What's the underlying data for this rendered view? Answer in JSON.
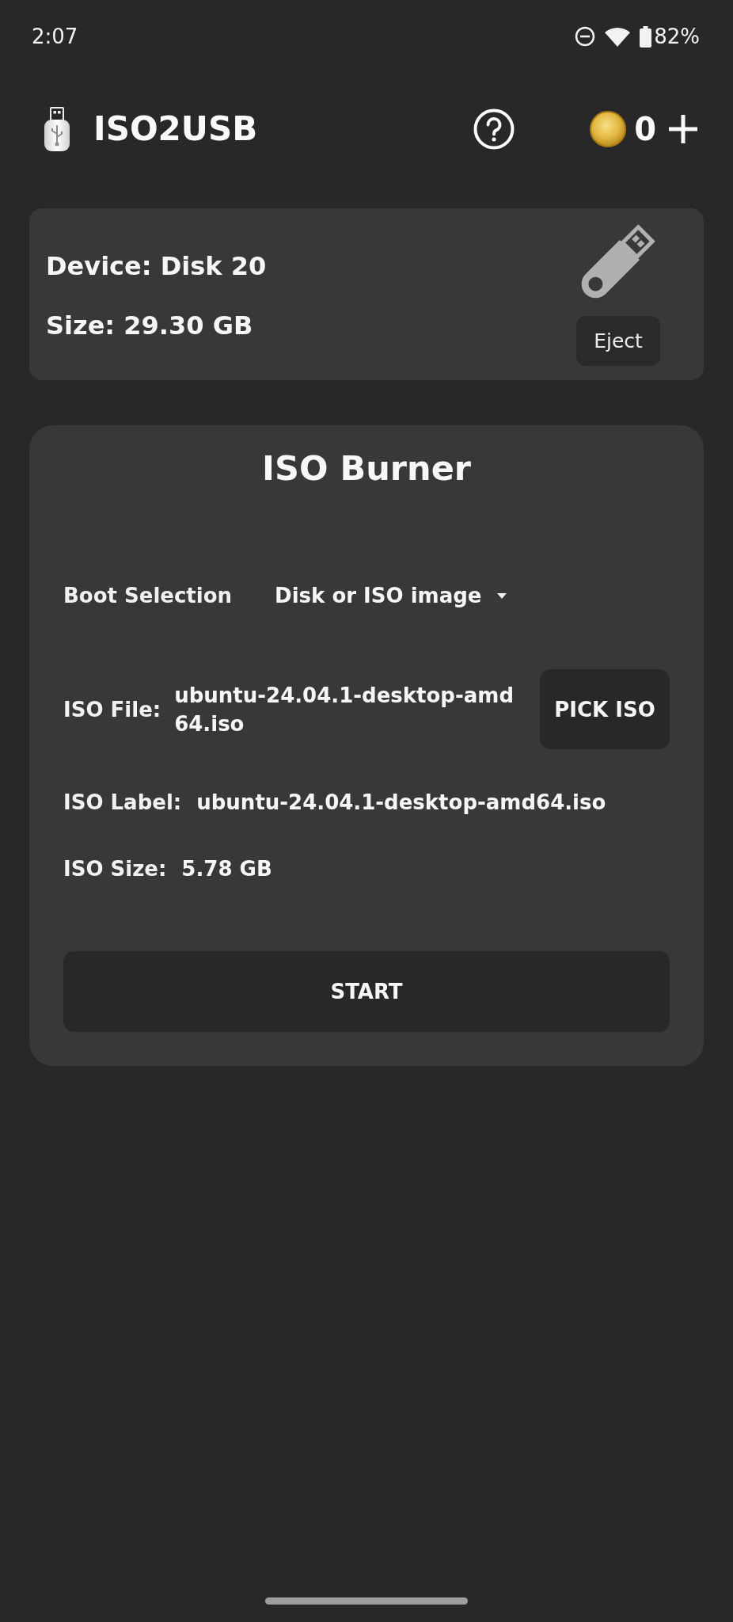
{
  "status_bar": {
    "time": "2:07",
    "battery": "82%"
  },
  "app_bar": {
    "title": "ISO2USB",
    "coins": "0"
  },
  "device_card": {
    "device": "Device: Disk 20",
    "size": "Size: 29.30 GB",
    "eject_button": "Eject"
  },
  "burner_card": {
    "title": "ISO Burner",
    "boot_selection": {
      "label": "Boot Selection",
      "value": "Disk or ISO image"
    },
    "iso_file": {
      "label": "ISO File:",
      "value": "ubuntu-24.04.1-desktop-amd64.iso"
    },
    "pick_button": "PICK ISO",
    "info_rows": [
      {
        "label": "ISO Label:",
        "value": "ubuntu-24.04.1-desktop-amd64.iso"
      },
      {
        "label": "ISO Size:",
        "value": "5.78 GB"
      }
    ],
    "start_button": "START"
  }
}
